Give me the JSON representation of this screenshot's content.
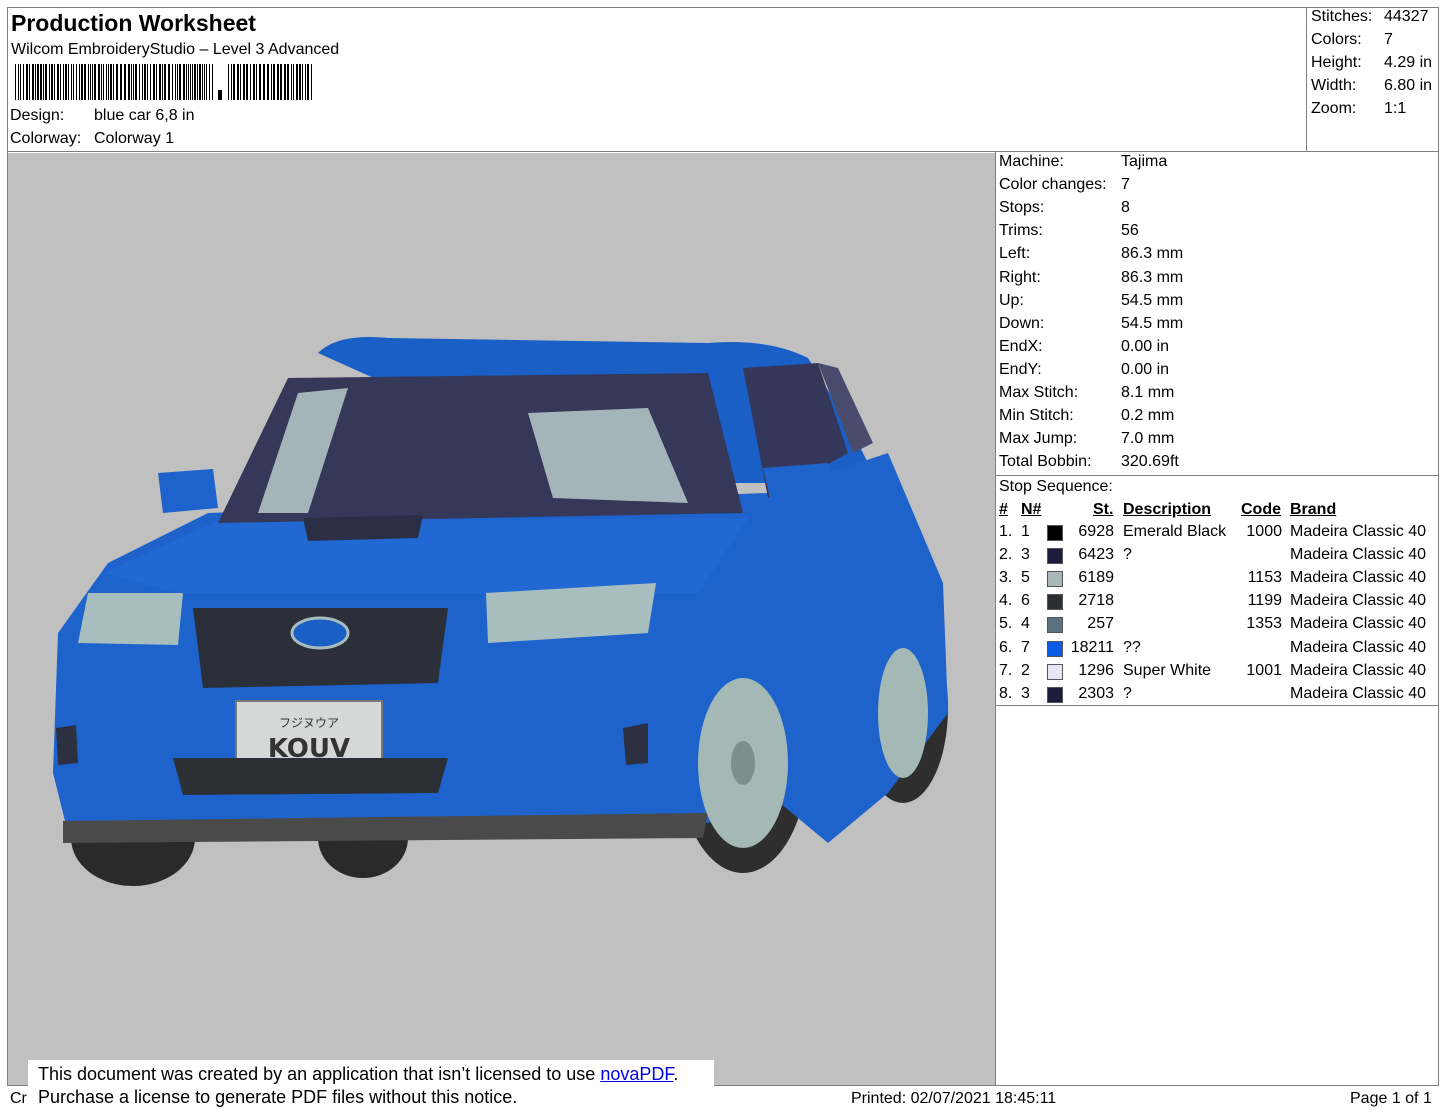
{
  "header": {
    "title": "Production Worksheet",
    "subtitle": "Wilcom EmbroideryStudio – Level 3 Advanced",
    "design_label": "Design:",
    "design_value": "blue car 6,8 in",
    "colorway_label": "Colorway:",
    "colorway_value": "Colorway 1"
  },
  "stats": {
    "stitches_label": "Stitches:",
    "stitches_value": "44327",
    "colors_label": "Colors:",
    "colors_value": "7",
    "height_label": "Height:",
    "height_value": "4.29 in",
    "width_label": "Width:",
    "width_value": "6.80 in",
    "zoom_label": "Zoom:",
    "zoom_value": "1:1"
  },
  "machine_info": [
    {
      "label": "Machine:",
      "value": "Tajima"
    },
    {
      "label": "Color changes:",
      "value": "7"
    },
    {
      "label": "Stops:",
      "value": "8"
    },
    {
      "label": "Trims:",
      "value": "56"
    },
    {
      "label": "Left:",
      "value": "86.3 mm"
    },
    {
      "label": "Right:",
      "value": "86.3 mm"
    },
    {
      "label": "Up:",
      "value": "54.5 mm"
    },
    {
      "label": "Down:",
      "value": "54.5 mm"
    },
    {
      "label": "EndX:",
      "value": "0.00 in"
    },
    {
      "label": "EndY:",
      "value": "0.00 in"
    },
    {
      "label": "Max Stitch:",
      "value": "8.1 mm"
    },
    {
      "label": "Min Stitch:",
      "value": "0.2 mm"
    },
    {
      "label": "Max Jump:",
      "value": "7.0 mm"
    },
    {
      "label": "Total Bobbin:",
      "value": "320.69ft"
    }
  ],
  "stop_sequence": {
    "title": "Stop Sequence:",
    "headers": {
      "num": "#",
      "n": "N#",
      "st": "St.",
      "desc": "Description",
      "code": "Code",
      "brand": "Brand"
    },
    "rows": [
      {
        "num": "1.",
        "n": "1",
        "color": "#000000",
        "st": "6928",
        "desc": "Emerald Black",
        "code": "1000",
        "brand": "Madeira Classic 40"
      },
      {
        "num": "2.",
        "n": "3",
        "color": "#1c1c3c",
        "st": "6423",
        "desc": "?",
        "code": "",
        "brand": "Madeira Classic 40"
      },
      {
        "num": "3.",
        "n": "5",
        "color": "#a9b7bb",
        "st": "6189",
        "desc": "",
        "code": "1153",
        "brand": "Madeira Classic 40"
      },
      {
        "num": "4.",
        "n": "6",
        "color": "#2b2f33",
        "st": "2718",
        "desc": "",
        "code": "1199",
        "brand": "Madeira Classic 40"
      },
      {
        "num": "5.",
        "n": "4",
        "color": "#5d7281",
        "st": "257",
        "desc": "",
        "code": "1353",
        "brand": "Madeira Classic 40"
      },
      {
        "num": "6.",
        "n": "7",
        "color": "#0a5ce6",
        "st": "18211",
        "desc": "??",
        "code": "",
        "brand": "Madeira Classic 40"
      },
      {
        "num": "7.",
        "n": "2",
        "color": "#e6e6f4",
        "st": "1296",
        "desc": "Super White",
        "code": "1001",
        "brand": "Madeira Classic 40"
      },
      {
        "num": "8.",
        "n": "3",
        "color": "#1c1c3c",
        "st": "2303",
        "desc": "?",
        "code": "",
        "brand": "Madeira Classic 40"
      }
    ]
  },
  "preview": {
    "plate_text": "KOUV",
    "plate_top_text": "フジヌウア"
  },
  "notice": {
    "line1_prefix": "This document was created by an application that isn’t licensed to use ",
    "line1_link": "novaPDF",
    "line1_suffix": ".",
    "line2": "Purchase a license to generate PDF files without this notice."
  },
  "footer": {
    "cr": "Cr",
    "printed": "Printed: 02/07/2021 18:45:11",
    "page": "Page 1 of 1"
  }
}
